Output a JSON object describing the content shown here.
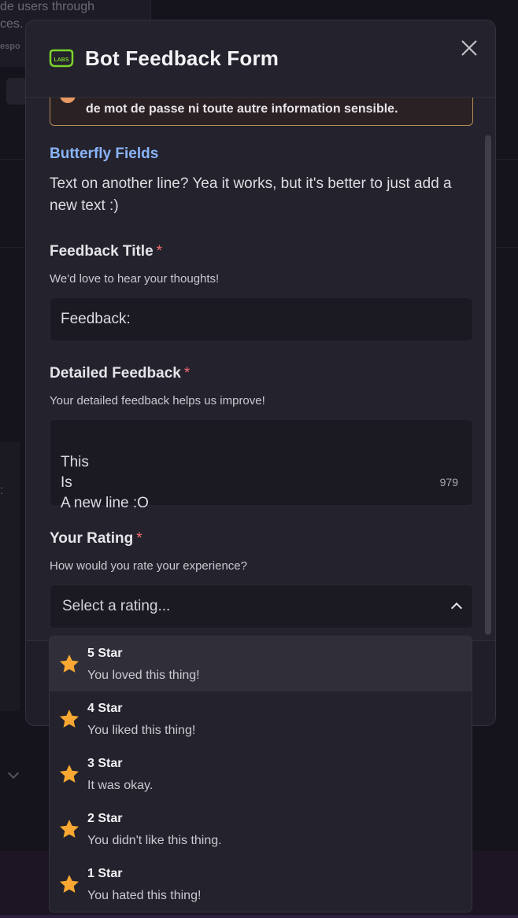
{
  "background": {
    "card_text_line1": "de users through",
    "card_text_line2": "ces.",
    "card_small_text": "espo"
  },
  "modal": {
    "title": "Bot Feedback Form",
    "bot_icon_label": "LABS",
    "warning": {
      "text": "de mot de passe ni toute autre information sensible."
    },
    "section": {
      "heading": "Butterfly Fields",
      "text": "Text on another line? Yea it works, but it's better to just add a new text :)"
    },
    "fields": {
      "title": {
        "label": "Feedback Title",
        "required_mark": "*",
        "description": "We'd love to hear your thoughts!",
        "value": "Feedback:"
      },
      "detailed": {
        "label": "Detailed Feedback",
        "required_mark": "*",
        "description": "Your detailed feedback helps us improve!",
        "value": "This\nIs\nA new line :O",
        "char_count": "979"
      },
      "rating": {
        "label": "Your Rating",
        "required_mark": "*",
        "description": "How would you rate your experience?",
        "placeholder": "Select a rating...",
        "options": [
          {
            "title": "5 Star",
            "description": "You loved this thing!"
          },
          {
            "title": "4 Star",
            "description": "You liked this thing!"
          },
          {
            "title": "3 Star",
            "description": "It was okay."
          },
          {
            "title": "2 Star",
            "description": "You didn't like this thing."
          },
          {
            "title": "1 Star",
            "description": "You hated this thing!"
          }
        ]
      }
    }
  },
  "colors": {
    "accent_heading": "#8ab4f8",
    "required": "#f26d75",
    "star": "#f8a832",
    "warning_border": "#b58a57",
    "bot_icon": "#7bd32b"
  }
}
